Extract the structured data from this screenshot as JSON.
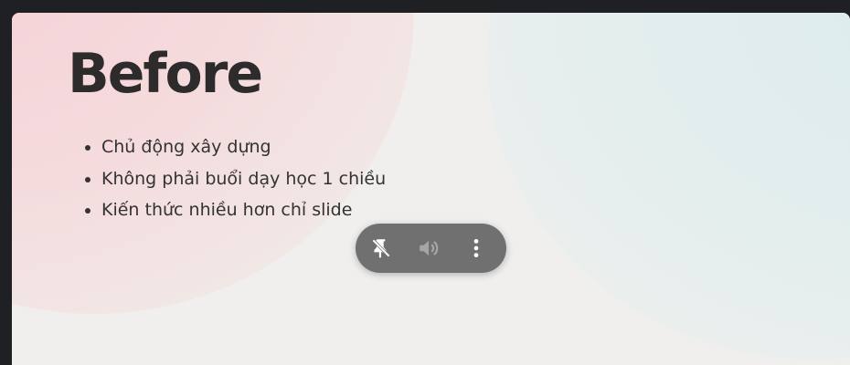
{
  "slide": {
    "title": "Before",
    "bullets": [
      "Chủ động xây dựng",
      "Không phải buổi dạy học 1 chiều",
      "Kiến thức nhiều hơn chỉ slide"
    ]
  },
  "toolbar": {
    "buttons": [
      {
        "icon": "unpin-icon"
      },
      {
        "icon": "volume-icon"
      },
      {
        "icon": "more-vertical-icon"
      }
    ]
  },
  "colors": {
    "background": "#1f2024",
    "slide": "#f0efed",
    "pink_accent": "#f6cfd5",
    "teal_accent": "#dcecec",
    "toolbar": "#707070",
    "text": "#2d2b2b"
  }
}
